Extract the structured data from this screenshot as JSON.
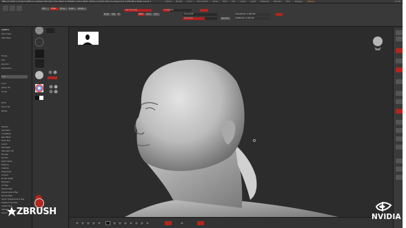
{
  "window": {
    "title": "ZBrush 2023.1 Custom Edition ▸ Default ZScript ▸ Free Mem 6.183GB ▸ Active Mem 1033 ▸ Scratch Disk 0 ▸ PolyCount 4.056 MP ▸ Mesh Count 1"
  },
  "menu": {
    "items": [
      "Alpha",
      "Brush",
      "Color",
      "Document",
      "Draw",
      "Dynamics",
      "Edit",
      "File",
      "Layer",
      "Light",
      "Macro",
      "Marker",
      "Material",
      "Movie",
      "Picker",
      "Preferences",
      "Render",
      "Stencil",
      "Stroke",
      "Texture",
      "Tool",
      "Transform",
      "Zplugin",
      "Zscript"
    ],
    "accent_item": "Menus",
    "clock": "12:08"
  },
  "shelf": {
    "edit_label": "Edit",
    "draw_label": "Draw",
    "move_label": "Move",
    "scale_label": "Scale",
    "rotate_label": "Rotate",
    "mrgb_label": "Mrgb",
    "rgb_label": "Rgb",
    "m_label": "M",
    "zadd_label": "Zadd",
    "zsub_label": "Zsub",
    "zcut_label": "Zcut",
    "focal_shift": {
      "label": "Focal Shift",
      "value": 0
    },
    "z_intensity": {
      "label": "Z Intensity",
      "value": 25
    },
    "draw_size": {
      "label": "Draw Size",
      "value": 64
    },
    "rgb_intensity": {
      "label": "Rgb Intensity",
      "value": 100
    },
    "dynamic_label": "Dynamic",
    "active_points": "ActivePoints: 4.056 Mil",
    "total_points": "TotalPoints: 4.056 Mil"
  },
  "left_palette": {
    "items": [
      "Lightbox",
      "Quick Save",
      "View Mask",
      "Transp",
      "Solo",
      "Dynamic",
      "Perspective",
      "Floor",
      "Local",
      "Gizmo 3D",
      "Frame",
      "Move",
      "Zoom 3D",
      "Rotate"
    ],
    "sub_items": [
      "Subtool",
      "Geometry",
      "ArrayMesh",
      "NanoMesh",
      "Thick Skin",
      "Layers",
      "FiberMesh",
      "Geometry HD",
      "Preview",
      "Surface",
      "Deformation",
      "Masking",
      "Visibility",
      "Polygroups",
      "Contact",
      "Morph Target",
      "Polypaint",
      "UV Map",
      "Texture Map",
      "Displacement Map",
      "Normal Map",
      "Vector Displacement Map",
      "Display Properties",
      "Unified Skin",
      "Initialize",
      "Import",
      "Export"
    ]
  },
  "colors": {
    "accent": "#b3261e",
    "ui_dark": "#2b2b2b",
    "canvas": "#2e2e2e",
    "sculpt": "#c9c9c9"
  },
  "branding": {
    "zbrush_logo_text": "ZBRUSH",
    "nvidia_logo_text": "NVIDIA"
  },
  "icons": [
    "zbrush-logo-icon",
    "nvidia-logo-icon",
    "silhouette-thumbnail-icon",
    "navigation-head-icon",
    "color-wheel-icon",
    "material-sphere-icon",
    "brush-icon",
    "stroke-icon",
    "alpha-icon"
  ]
}
